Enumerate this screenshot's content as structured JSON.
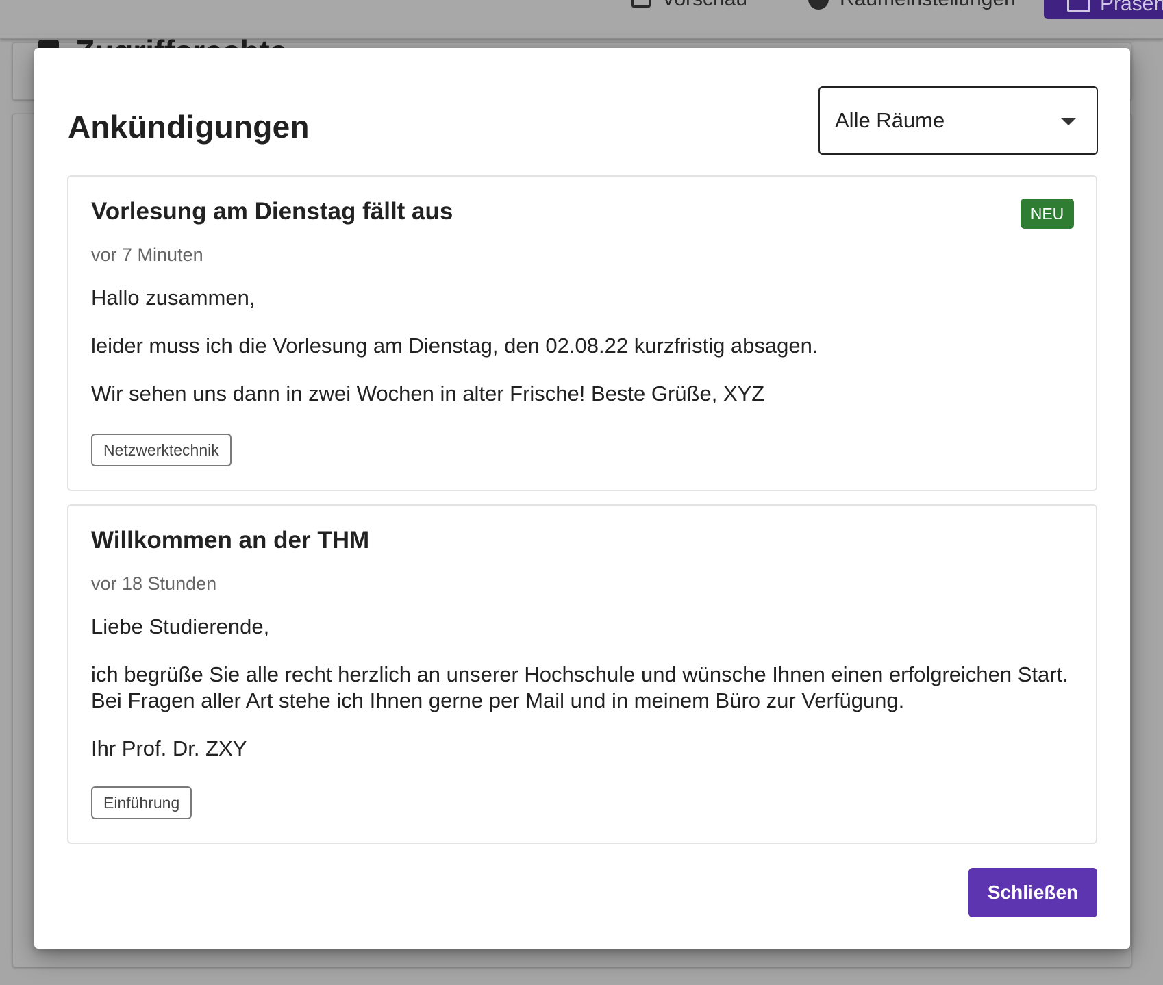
{
  "background": {
    "toolbar": {
      "preview_label": "Vorschau",
      "room_settings_label": "Raumeinstellungen",
      "present_label": "Präsen"
    },
    "section_heading": "Zugriffsrechte"
  },
  "dialog": {
    "title": "Ankündigungen",
    "room_filter": {
      "selected": "Alle Räume"
    },
    "announcements": [
      {
        "title": "Vorlesung am Dienstag fällt aus",
        "time": "vor 7 Minuten",
        "badge": "NEU",
        "paragraphs": [
          "Hallo zusammen,",
          "leider muss ich die Vorlesung am Dienstag, den 02.08.22 kurzfristig absagen.",
          "Wir sehen uns dann in zwei Wochen in alter Frische! Beste Grüße, XYZ"
        ],
        "tag": "Netzwerktechnik"
      },
      {
        "title": "Willkommen an der THM",
        "time": "vor 18 Stunden",
        "paragraphs": [
          "Liebe Studierende,",
          "ich begrüße Sie alle recht herzlich an unserer Hochschule und wünsche Ihnen einen erfolgreichen Start. Bei Fragen aller Art stehe ich Ihnen gerne per Mail und in meinem Büro zur Verfügung.",
          "Ihr Prof. Dr. ZXY"
        ],
        "tag": "Einführung"
      }
    ],
    "close_label": "Schließen"
  },
  "colors": {
    "accent": "#5e35b1",
    "badge_new": "#2e7d32",
    "backdrop": "#a6a6a6"
  }
}
